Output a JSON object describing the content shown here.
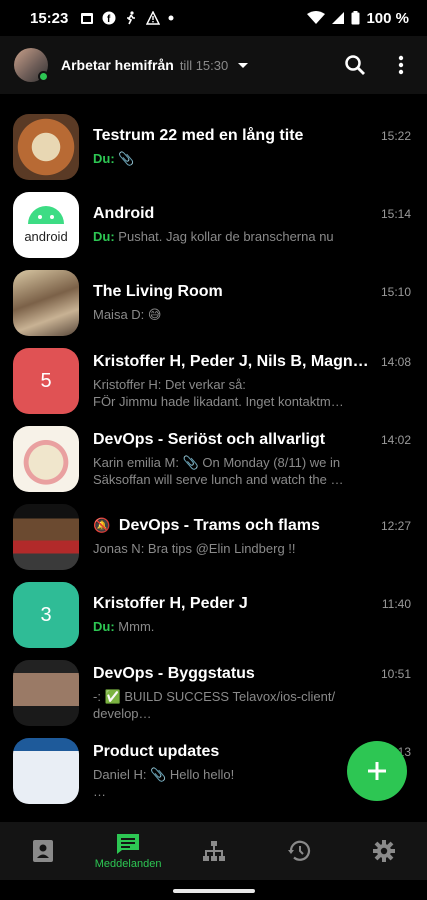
{
  "status_bar": {
    "time": "15:23",
    "battery": "100 %",
    "icons": [
      "calendar-icon",
      "facebook-icon",
      "running-icon",
      "warning-icon",
      "dot-icon",
      "wifi-icon",
      "signal-icon",
      "battery-icon"
    ]
  },
  "header": {
    "status": "Arbetar hemifrån",
    "until": "till 15:30",
    "icons": [
      "search-icon",
      "more-vert-icon"
    ]
  },
  "conversations": [
    {
      "title": "Testrum 22 med en lång tite",
      "time": "15:22",
      "sender": "Du:",
      "preview": "📎",
      "preview2": ""
    },
    {
      "title": "Android",
      "time": "15:14",
      "sender": "Du:",
      "preview": "Pushat. Jag kollar de branscherna nu",
      "preview2": ""
    },
    {
      "title": "The Living Room",
      "time": "15:10",
      "sender": "",
      "preview": "Maisa D: 😅",
      "preview2": ""
    },
    {
      "title": "Kristoffer H, Peder J, Nils B, Magnus…",
      "time": "14:08",
      "sender": "",
      "badge": "5",
      "preview": "Kristoffer H: Det verkar så:",
      "preview2": "FÖr Jimmu hade likadant. Inget kontaktm…"
    },
    {
      "title": "DevOps - Seriöst och allvarligt",
      "time": "14:02",
      "sender": "",
      "preview": "Karin emilia M: 📎 On Monday (8/11) we in",
      "preview2": "Säksoffan will serve lunch and watch the …"
    },
    {
      "title": "DevOps - Trams och flams",
      "time": "12:27",
      "sender": "",
      "muted": "🔕",
      "preview": "Jonas N: Bra tips @Elin Lindberg !!",
      "preview2": ""
    },
    {
      "title": "Kristoffer H, Peder J",
      "time": "11:40",
      "sender": "Du:",
      "badge": "3",
      "preview": "Mmm.",
      "preview2": ""
    },
    {
      "title": "DevOps - Byggstatus",
      "time": "10:51",
      "sender": "",
      "preview": "-: ✅ BUILD SUCCESS Telavox/ios-client/",
      "preview2": "develop…"
    },
    {
      "title": "Product updates",
      "time": "…13",
      "sender": "",
      "preview": "Daniel H: 📎 Hello hello!",
      "preview2": "…"
    }
  ],
  "android_logo_text": "android",
  "bottom_nav": {
    "items": [
      "contacts-icon",
      "messages-icon",
      "org-icon",
      "history-icon",
      "settings-icon"
    ],
    "active_label": "Meddelanden"
  },
  "colors": {
    "accent": "#2dc653",
    "red_badge": "#e05254",
    "teal_badge": "#2fbc96"
  }
}
